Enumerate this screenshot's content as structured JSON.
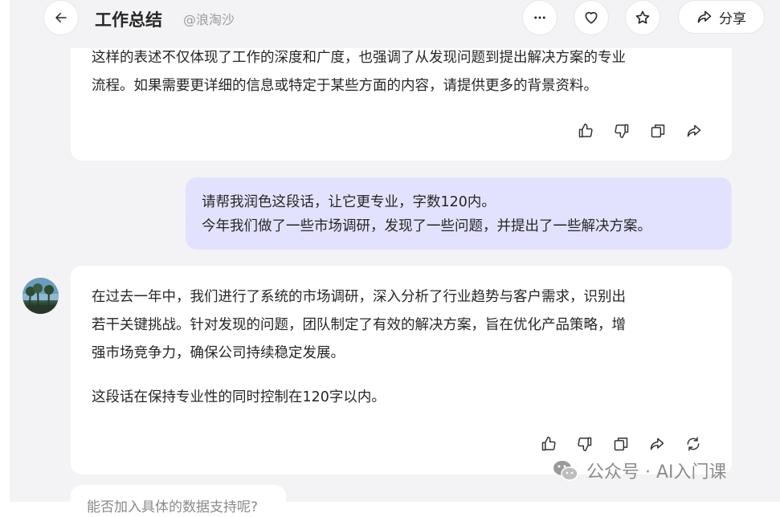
{
  "header": {
    "title": "工作总结",
    "handle": "@浪淘沙",
    "share_label": "分享"
  },
  "messages": {
    "ai_prev": {
      "lines": [
        "这样的表述不仅体现了工作的深度和广度，也强调了从发现问题到提出解决方案的专业",
        "流程。如果需要更详细的信息或特定于某些方面的内容，请提供更多的背景资料。"
      ]
    },
    "user": {
      "lines": [
        "请帮我润色这段话，让它更专业，字数120内。",
        "今年我们做了一些市场调研，发现了一些问题，并提出了一些解决方案。"
      ]
    },
    "ai_reply": {
      "lines": [
        "在过去一年中，我们进行了系统的市场调研，深入分析了行业趋势与客户需求，识别出",
        "若干关键挑战。针对发现的问题，团队制定了有效的解决方案，旨在优化产品策略，增",
        "强市场竞争力，确保公司持续稳定发展。"
      ],
      "note": "这段话在保持专业性的同时控制在120字以内。"
    },
    "suggestion": "能否加入具体的数据支持呢?"
  },
  "watermark": "公众号 · AI入门课",
  "icons": {
    "back": "arrow-left-icon",
    "more": "more-dots-icon",
    "like": "heart-icon",
    "favorite": "star-icon",
    "share": "share-arrow-icon",
    "thumb_up": "thumb-up-icon",
    "thumb_down": "thumb-down-icon",
    "copy": "copy-icon",
    "forward": "share-arrow-icon",
    "regenerate": "refresh-icon"
  },
  "colors": {
    "chat_bg": "#f3f3f5",
    "user_bubble": "#e3e2fe",
    "text": "#262626",
    "muted": "#9a9aa3"
  }
}
